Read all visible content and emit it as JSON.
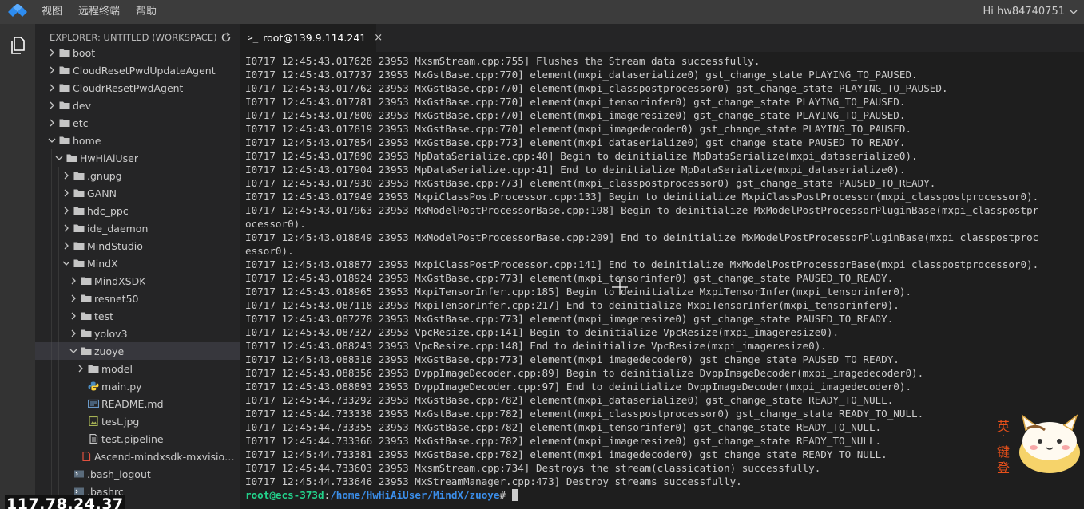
{
  "menubar": {
    "items": [
      "视图",
      "远程终端",
      "帮助"
    ],
    "user": "Hi hw84740751"
  },
  "explorer": {
    "title": "EXPLORER: UNTITLED (WORKSPACE)",
    "tree": [
      {
        "label": "boot",
        "depth": 0,
        "type": "folder",
        "state": "collapsed"
      },
      {
        "label": "CloudResetPwdUpdateAgent",
        "depth": 0,
        "type": "folder",
        "state": "collapsed"
      },
      {
        "label": "CloudrResetPwdAgent",
        "depth": 0,
        "type": "folder",
        "state": "collapsed"
      },
      {
        "label": "dev",
        "depth": 0,
        "type": "folder",
        "state": "collapsed"
      },
      {
        "label": "etc",
        "depth": 0,
        "type": "folder",
        "state": "collapsed"
      },
      {
        "label": "home",
        "depth": 0,
        "type": "folder",
        "state": "expanded"
      },
      {
        "label": "HwHiAiUser",
        "depth": 1,
        "type": "folder",
        "state": "expanded"
      },
      {
        "label": ".gnupg",
        "depth": 2,
        "type": "folder",
        "state": "collapsed"
      },
      {
        "label": "GANN",
        "depth": 2,
        "type": "folder",
        "state": "collapsed"
      },
      {
        "label": "hdc_ppc",
        "depth": 2,
        "type": "folder",
        "state": "collapsed"
      },
      {
        "label": "ide_daemon",
        "depth": 2,
        "type": "folder",
        "state": "collapsed"
      },
      {
        "label": "MindStudio",
        "depth": 2,
        "type": "folder",
        "state": "collapsed"
      },
      {
        "label": "MindX",
        "depth": 2,
        "type": "folder",
        "state": "expanded"
      },
      {
        "label": "MindXSDK",
        "depth": 3,
        "type": "folder",
        "state": "collapsed"
      },
      {
        "label": "resnet50",
        "depth": 3,
        "type": "folder",
        "state": "collapsed"
      },
      {
        "label": "test",
        "depth": 3,
        "type": "folder",
        "state": "collapsed"
      },
      {
        "label": "yolov3",
        "depth": 3,
        "type": "folder",
        "state": "collapsed"
      },
      {
        "label": "zuoye",
        "depth": 3,
        "type": "folder",
        "state": "expanded",
        "selected": true
      },
      {
        "label": "model",
        "depth": 4,
        "type": "folder",
        "state": "collapsed"
      },
      {
        "label": "main.py",
        "depth": 4,
        "type": "python"
      },
      {
        "label": "README.md",
        "depth": 4,
        "type": "markdown"
      },
      {
        "label": "test.jpg",
        "depth": 4,
        "type": "image"
      },
      {
        "label": "test.pipeline",
        "depth": 4,
        "type": "file"
      },
      {
        "label": "Ascend-mindxsdk-mxvision_2.0.1_linux-aarch64.run",
        "depth": 3,
        "type": "run"
      },
      {
        "label": ".bash_logout",
        "depth": 2,
        "type": "shell"
      },
      {
        "label": ".bashrc",
        "depth": 2,
        "type": "shell"
      }
    ]
  },
  "terminal": {
    "tab_label": "root@139.9.114.241",
    "tab_prompt": ">_",
    "tab_close": "×",
    "lines": [
      "I0717 12:45:43.017628 23953 MxsmStream.cpp:755] Flushes the Stream data successfully.",
      "I0717 12:45:43.017737 23953 MxGstBase.cpp:770] element(mxpi_dataserialize0) gst_change_state PLAYING_TO_PAUSED.",
      "I0717 12:45:43.017762 23953 MxGstBase.cpp:770] element(mxpi_classpostprocessor0) gst_change_state PLAYING_TO_PAUSED.",
      "I0717 12:45:43.017781 23953 MxGstBase.cpp:770] element(mxpi_tensorinfer0) gst_change_state PLAYING_TO_PAUSED.",
      "I0717 12:45:43.017800 23953 MxGstBase.cpp:770] element(mxpi_imageresize0) gst_change_state PLAYING_TO_PAUSED.",
      "I0717 12:45:43.017819 23953 MxGstBase.cpp:770] element(mxpi_imagedecoder0) gst_change_state PLAYING_TO_PAUSED.",
      "I0717 12:45:43.017854 23953 MxGstBase.cpp:773] element(mxpi_dataserialize0) gst_change_state PAUSED_TO_READY.",
      "I0717 12:45:43.017890 23953 MpDataSerialize.cpp:40] Begin to deinitialize MpDataSerialize(mxpi_dataserialize0).",
      "I0717 12:45:43.017904 23953 MpDataSerialize.cpp:41] End to deinitialize MpDataSerialize(mxpi_dataserialize0).",
      "I0717 12:45:43.017930 23953 MxGstBase.cpp:773] element(mxpi_classpostprocessor0) gst_change_state PAUSED_TO_READY.",
      "I0717 12:45:43.017949 23953 MxpiClassPostProcessor.cpp:133] Begin to deinitialize MxpiClassPostProcessor(mxpi_classpostprocessor0).",
      "I0717 12:45:43.017963 23953 MxModelPostProcessorBase.cpp:198] Begin to deinitialize MxModelPostProcessorPluginBase(mxpi_classpostpr",
      "ocessor0).",
      "I0717 12:45:43.018849 23953 MxModelPostProcessorBase.cpp:209] End to deinitialize MxModelPostProcessorPluginBase(mxpi_classpostproc",
      "essor0).",
      "I0717 12:45:43.018877 23953 MxpiClassPostProcessor.cpp:141] End to deinitialize MxModelPostProcessorBase(mxpi_classpostprocessor0).",
      "I0717 12:45:43.018924 23953 MxGstBase.cpp:773] element(mxpi_tensorinfer0) gst_change_state PAUSED_TO_READY.",
      "I0717 12:45:43.018965 23953 MxpiTensorInfer.cpp:185] Begin to deinitialize MxpiTensorInfer(mxpi_tensorinfer0).",
      "I0717 12:45:43.087118 23953 MxpiTensorInfer.cpp:217] End to deinitialize MxpiTensorInfer(mxpi_tensorinfer0).",
      "I0717 12:45:43.087278 23953 MxGstBase.cpp:773] element(mxpi_imageresize0) gst_change_state PAUSED_TO_READY.",
      "I0717 12:45:43.087327 23953 VpcResize.cpp:141] Begin to deinitialize VpcResize(mxpi_imageresize0).",
      "I0717 12:45:43.088243 23953 VpcResize.cpp:148] End to deinitialize VpcResize(mxpi_imageresize0).",
      "I0717 12:45:43.088318 23953 MxGstBase.cpp:773] element(mxpi_imagedecoder0) gst_change_state PAUSED_TO_READY.",
      "I0717 12:45:43.088356 23953 DvppImageDecoder.cpp:89] Begin to deinitialize DvppImageDecoder(mxpi_imagedecoder0).",
      "I0717 12:45:43.088893 23953 DvppImageDecoder.cpp:97] End to deinitialize DvppImageDecoder(mxpi_imagedecoder0).",
      "I0717 12:45:44.733292 23953 MxGstBase.cpp:782] element(mxpi_dataserialize0) gst_change_state READY_TO_NULL.",
      "I0717 12:45:44.733338 23953 MxGstBase.cpp:782] element(mxpi_classpostprocessor0) gst_change_state READY_TO_NULL.",
      "I0717 12:45:44.733355 23953 MxGstBase.cpp:782] element(mxpi_tensorinfer0) gst_change_state READY_TO_NULL.",
      "I0717 12:45:44.733366 23953 MxGstBase.cpp:782] element(mxpi_imageresize0) gst_change_state READY_TO_NULL.",
      "I0717 12:45:44.733381 23953 MxGstBase.cpp:782] element(mxpi_imagedecoder0) gst_change_state READY_TO_NULL.",
      "I0717 12:45:44.733603 23953 MxsmStream.cpp:734] Destroys the stream(classication) successfully.",
      "I0717 12:45:44.733646 23953 MxStreamManager.cpp:473] Destroy streams successfully."
    ],
    "prompt_user": "root@ecs-373d",
    "prompt_sep": ":",
    "prompt_path": "/home/HwHiAiUser/MindX/zuoye",
    "prompt_symbol": "#"
  },
  "overlay": {
    "ip": "117.78.24.37"
  },
  "ime": {
    "chars": [
      "英",
      "·",
      "键",
      "登"
    ]
  },
  "colors": {
    "menubar": "#3c3c3c",
    "activitybar": "#333333",
    "sidebar": "#252526",
    "terminal_bg": "#1e1e1e",
    "prompt_user": "#23d18b",
    "prompt_path": "#3b8eea",
    "folder": "#c5c5c5",
    "python": "#4b8bbe",
    "image": "#a6b254",
    "run": "#e0513f",
    "shell": "#8fa0b3",
    "ime_accent": "#e8501a"
  }
}
